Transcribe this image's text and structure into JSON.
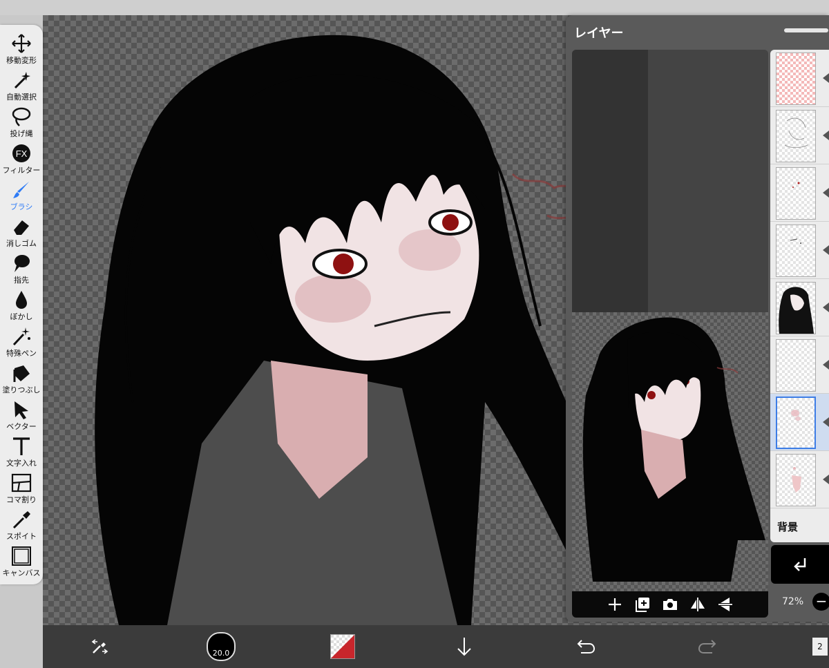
{
  "tools": [
    {
      "id": "move",
      "label": "移動変形",
      "icon": "move-arrows-icon"
    },
    {
      "id": "magic-wand",
      "label": "自動選択",
      "icon": "magic-wand-icon"
    },
    {
      "id": "lasso",
      "label": "投げ縄",
      "icon": "lasso-icon"
    },
    {
      "id": "filter",
      "label": "フィルター",
      "icon": "fx-icon"
    },
    {
      "id": "brush",
      "label": "ブラシ",
      "icon": "brush-icon",
      "active": true
    },
    {
      "id": "eraser",
      "label": "消しゴム",
      "icon": "eraser-icon"
    },
    {
      "id": "smudge",
      "label": "指先",
      "icon": "finger-icon"
    },
    {
      "id": "blur",
      "label": "ぼかし",
      "icon": "drop-icon"
    },
    {
      "id": "special-pen",
      "label": "特殊ペン",
      "icon": "sparkle-pen-icon"
    },
    {
      "id": "fill",
      "label": "塗りつぶし",
      "icon": "bucket-icon"
    },
    {
      "id": "vector",
      "label": "ベクター",
      "icon": "cursor-arrow-icon"
    },
    {
      "id": "text",
      "label": "文字入れ",
      "icon": "text-t-icon"
    },
    {
      "id": "frame",
      "label": "コマ割り",
      "icon": "panel-frame-icon"
    },
    {
      "id": "eyedropper",
      "label": "スポイト",
      "icon": "eyedropper-icon"
    },
    {
      "id": "canvas",
      "label": "キャンバス",
      "icon": "canvas-square-icon"
    }
  ],
  "layer_panel": {
    "title": "レイヤー",
    "background_label": "背景",
    "opacity": "72%",
    "opacity_minus": "−",
    "layers": [
      {
        "thumb": "pink"
      },
      {
        "thumb": "sketch"
      },
      {
        "thumb": "dots"
      },
      {
        "thumb": "dots"
      },
      {
        "thumb": "hair"
      },
      {
        "thumb": "empty"
      },
      {
        "thumb": "skin",
        "selected": true
      },
      {
        "thumb": "skin-light"
      }
    ]
  },
  "bottom_bar": {
    "brush_size": "20.0",
    "primary_color": "#c8262c",
    "page_indicator": "2"
  }
}
